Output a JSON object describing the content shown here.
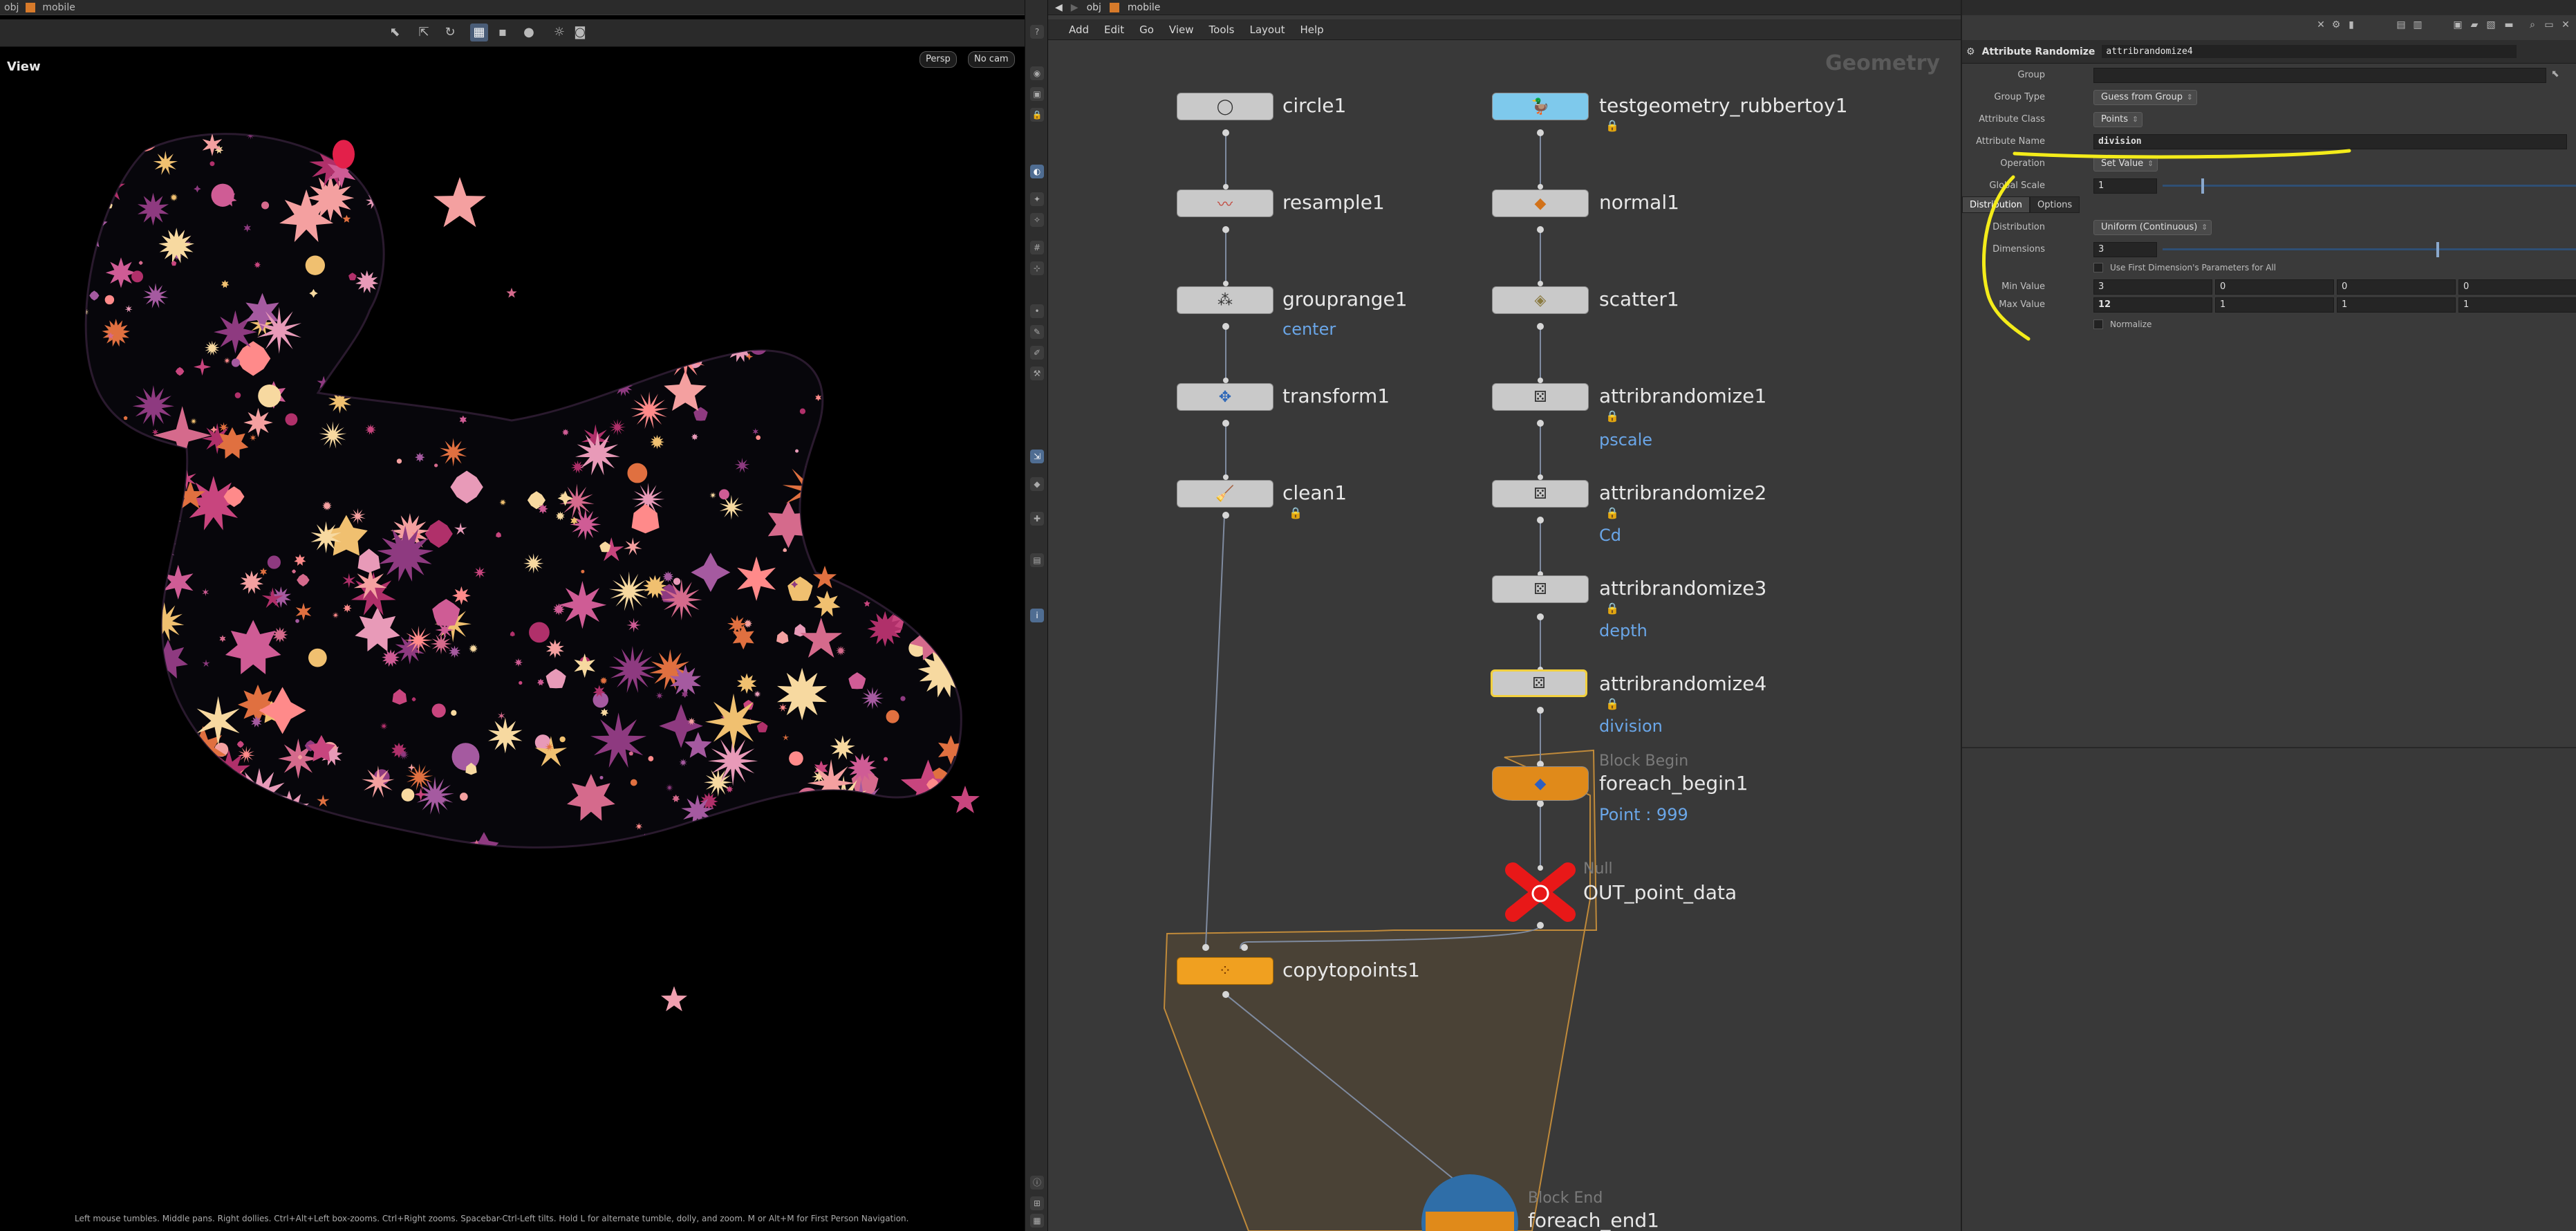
{
  "viewport": {
    "path": {
      "context": "obj",
      "node": "mobile"
    },
    "label": "View",
    "camera_mode": "Persp",
    "camera": "No cam",
    "help_text": "Left mouse tumbles. Middle pans. Right dollies. Ctrl+Alt+Left box-zooms. Ctrl+Right zooms. Spacebar-Ctrl-Left tilts. Hold L for alternate tumble, dolly, and zoom.  M or Alt+M for First Person Navigation."
  },
  "network": {
    "path": {
      "context": "obj",
      "node": "mobile"
    },
    "menu": [
      "Add",
      "Edit",
      "Go",
      "View",
      "Tools",
      "Layout",
      "Help"
    ],
    "context_label": "Geometry",
    "nodes": {
      "circle1": {
        "name": "circle1"
      },
      "resample1": {
        "name": "resample1"
      },
      "grouprange1": {
        "name": "grouprange1",
        "comment": "center"
      },
      "transform1": {
        "name": "transform1"
      },
      "clean1": {
        "name": "clean1"
      },
      "testgeometry_rubbertoy1": {
        "name": "testgeometry_rubbertoy1"
      },
      "normal1": {
        "name": "normal1"
      },
      "scatter1": {
        "name": "scatter1"
      },
      "attribrandomize1": {
        "name": "attribrandomize1",
        "comment": "pscale"
      },
      "attribrandomize2": {
        "name": "attribrandomize2",
        "comment": "Cd"
      },
      "attribrandomize3": {
        "name": "attribrandomize3",
        "comment": "depth"
      },
      "attribrandomize4": {
        "name": "attribrandomize4",
        "comment": "division"
      },
      "foreach_begin1": {
        "name": "foreach_begin1",
        "type": "Block Begin",
        "comment": "Point : 999"
      },
      "OUT_point_data": {
        "name": "OUT_point_data",
        "type": "Null"
      },
      "copytopoints1": {
        "name": "copytopoints1"
      },
      "foreach_end1": {
        "name": "foreach_end1",
        "type": "Block End"
      }
    }
  },
  "params": {
    "node_type": "Attribute Randomize",
    "node_name": "attribrandomize4",
    "group": {
      "label": "Group",
      "value": ""
    },
    "group_type": {
      "label": "Group Type",
      "value": "Guess from Group"
    },
    "attribute_class": {
      "label": "Attribute Class",
      "value": "Points"
    },
    "attribute_name": {
      "label": "Attribute Name",
      "value": "division"
    },
    "operation": {
      "label": "Operation",
      "value": "Set Value"
    },
    "global_scale": {
      "label": "Global Scale",
      "value": "1"
    },
    "tabs": [
      "Distribution",
      "Options"
    ],
    "distribution": {
      "label": "Distribution",
      "value": "Uniform (Continuous)"
    },
    "dimensions": {
      "label": "Dimensions",
      "value": "3"
    },
    "use_first_dimension": {
      "label": "Use First Dimension's Parameters for All",
      "checked": false
    },
    "min_value": {
      "label": "Min Value",
      "values": [
        "3",
        "0",
        "0",
        "0"
      ]
    },
    "max_value": {
      "label": "Max Value",
      "values": [
        "12",
        "1",
        "1",
        "1"
      ]
    },
    "normalize": {
      "label": "Normalize",
      "checked": false
    }
  },
  "colors": {
    "selected_outline": "#f2d03e",
    "annotation": "#f4ec1a",
    "comment_text": "#6aa6e8",
    "loop_block": "#f0a020",
    "null_node": "#e81818"
  }
}
